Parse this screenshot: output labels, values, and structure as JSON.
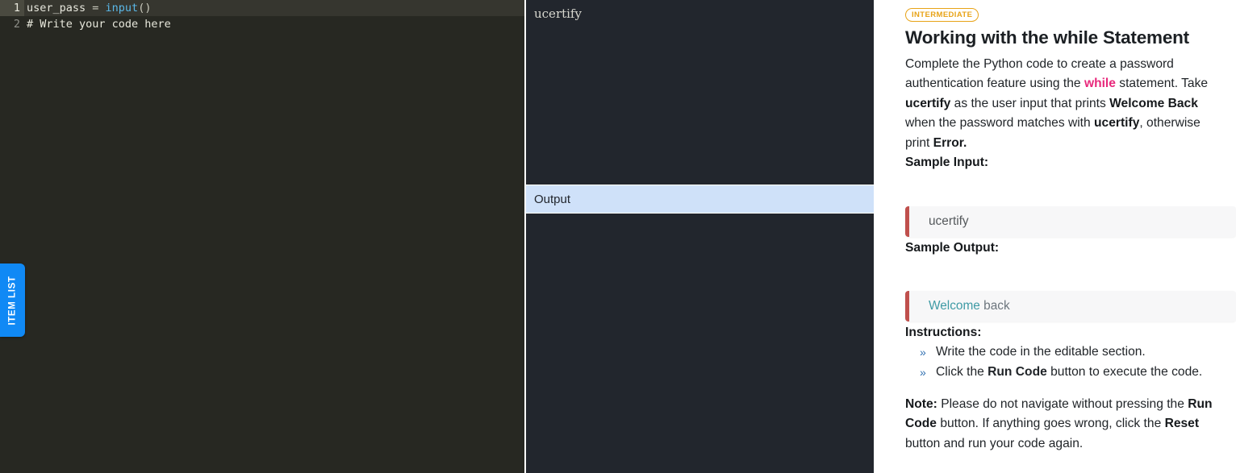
{
  "editor": {
    "name": "python-code-editor",
    "lines": [
      {
        "number": "1",
        "active": true,
        "tokens": [
          {
            "text": "user_pass ",
            "type": "name"
          },
          {
            "text": "= ",
            "type": "punct"
          },
          {
            "text": "input",
            "type": "fn"
          },
          {
            "text": "()",
            "type": "punct"
          }
        ]
      },
      {
        "number": "2",
        "active": false,
        "tokens": [
          {
            "text": "# Write your code here",
            "type": "comment"
          }
        ]
      }
    ],
    "item_list_tab_label": "ITEM LIST"
  },
  "io": {
    "input_value": "ucertify",
    "output_header_label": "Output",
    "output_value": ""
  },
  "instructions": {
    "badge": "INTERMEDIATE",
    "title": "Working with the while Statement",
    "description_parts": [
      {
        "text": "Complete the Python code to create a password authentication feature using the ",
        "style": "normal"
      },
      {
        "text": "while",
        "style": "keyword"
      },
      {
        "text": " statement. Take ",
        "style": "normal"
      },
      {
        "text": "ucertify",
        "style": "bold"
      },
      {
        "text": " as the user input that prints ",
        "style": "normal"
      },
      {
        "text": "Welcome Back",
        "style": "bold"
      },
      {
        "text": " when the password matches with ",
        "style": "normal"
      },
      {
        "text": "ucertify",
        "style": "bold"
      },
      {
        "text": ", otherwise print ",
        "style": "normal"
      },
      {
        "text": "Error.",
        "style": "bold"
      }
    ],
    "sample_input_label": "Sample Input:",
    "sample_input_code": "ucertify",
    "sample_output_label": "Sample Output:",
    "sample_output_code_kw": "Welcome",
    "sample_output_code_rest": " back",
    "instructions_label": "Instructions:",
    "bullet_glyph": "»",
    "steps": [
      {
        "parts": [
          {
            "text": "Write the code in the editable section.",
            "style": "normal"
          }
        ]
      },
      {
        "parts": [
          {
            "text": "Click the ",
            "style": "normal"
          },
          {
            "text": "Run Code",
            "style": "bold"
          },
          {
            "text": " button to execute the code.",
            "style": "normal"
          }
        ]
      }
    ],
    "note_parts": [
      {
        "text": "Note:",
        "style": "bold"
      },
      {
        "text": " Please do not navigate without pressing the ",
        "style": "normal"
      },
      {
        "text": "Run Code",
        "style": "bold"
      },
      {
        "text": " button. If anything goes wrong, click the ",
        "style": "normal"
      },
      {
        "text": "Reset",
        "style": "bold"
      },
      {
        "text": " button and run your code again.",
        "style": "normal"
      }
    ]
  },
  "colors": {
    "editor_bg": "#272822",
    "io_bg": "#22262d",
    "output_header_bg": "#cfe1f9",
    "item_list_tab_bg": "#1089f5",
    "badge_border": "#e8a317",
    "keyword_pink": "#e8287b",
    "code_block_border": "#c0504d",
    "code_block_bg": "#f7f7f8",
    "output_keyword_teal": "#3f9ba5"
  }
}
